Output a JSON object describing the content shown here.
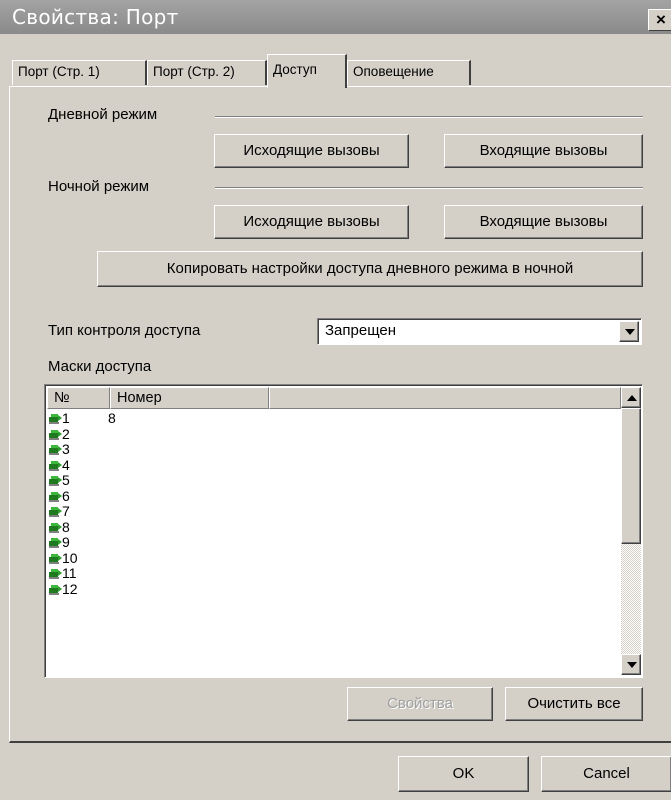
{
  "window": {
    "title": "Свойства: Порт",
    "close_label": "×"
  },
  "tabs": [
    {
      "label": "Порт (Стр. 1)"
    },
    {
      "label": "Порт (Стр. 2)"
    },
    {
      "label": "Доступ",
      "active": true
    },
    {
      "label": "Оповещение"
    }
  ],
  "day_mode": {
    "label": "Дневной режим",
    "outgoing_label": "Исходящие вызовы",
    "incoming_label": "Входящие вызовы"
  },
  "night_mode": {
    "label": "Ночной режим",
    "outgoing_label": "Исходящие вызовы",
    "incoming_label": "Входящие вызовы"
  },
  "copy_button_label": "Копировать настройки доступа дневного режима в ночной",
  "access_control": {
    "label": "Тип контроля доступа",
    "selected": "Запрещен"
  },
  "masks": {
    "label": "Маски доступа",
    "columns": [
      "№",
      "Номер"
    ],
    "rows": [
      {
        "n": "1",
        "number": "8"
      },
      {
        "n": "2",
        "number": ""
      },
      {
        "n": "3",
        "number": ""
      },
      {
        "n": "4",
        "number": ""
      },
      {
        "n": "5",
        "number": ""
      },
      {
        "n": "6",
        "number": ""
      },
      {
        "n": "7",
        "number": ""
      },
      {
        "n": "8",
        "number": ""
      },
      {
        "n": "9",
        "number": ""
      },
      {
        "n": "10",
        "number": ""
      },
      {
        "n": "11",
        "number": ""
      },
      {
        "n": "12",
        "number": ""
      }
    ],
    "row_icon": "phone-line-icon"
  },
  "list_buttons": {
    "properties_label": "Свойства",
    "properties_enabled": false,
    "clear_all_label": "Очистить все"
  },
  "footer": {
    "ok_label": "OK",
    "cancel_label": "Cancel"
  },
  "colors": {
    "titlebar": "#8f8f8f",
    "face": "#d4d0c8",
    "icon_green": "#2e9e2e"
  }
}
